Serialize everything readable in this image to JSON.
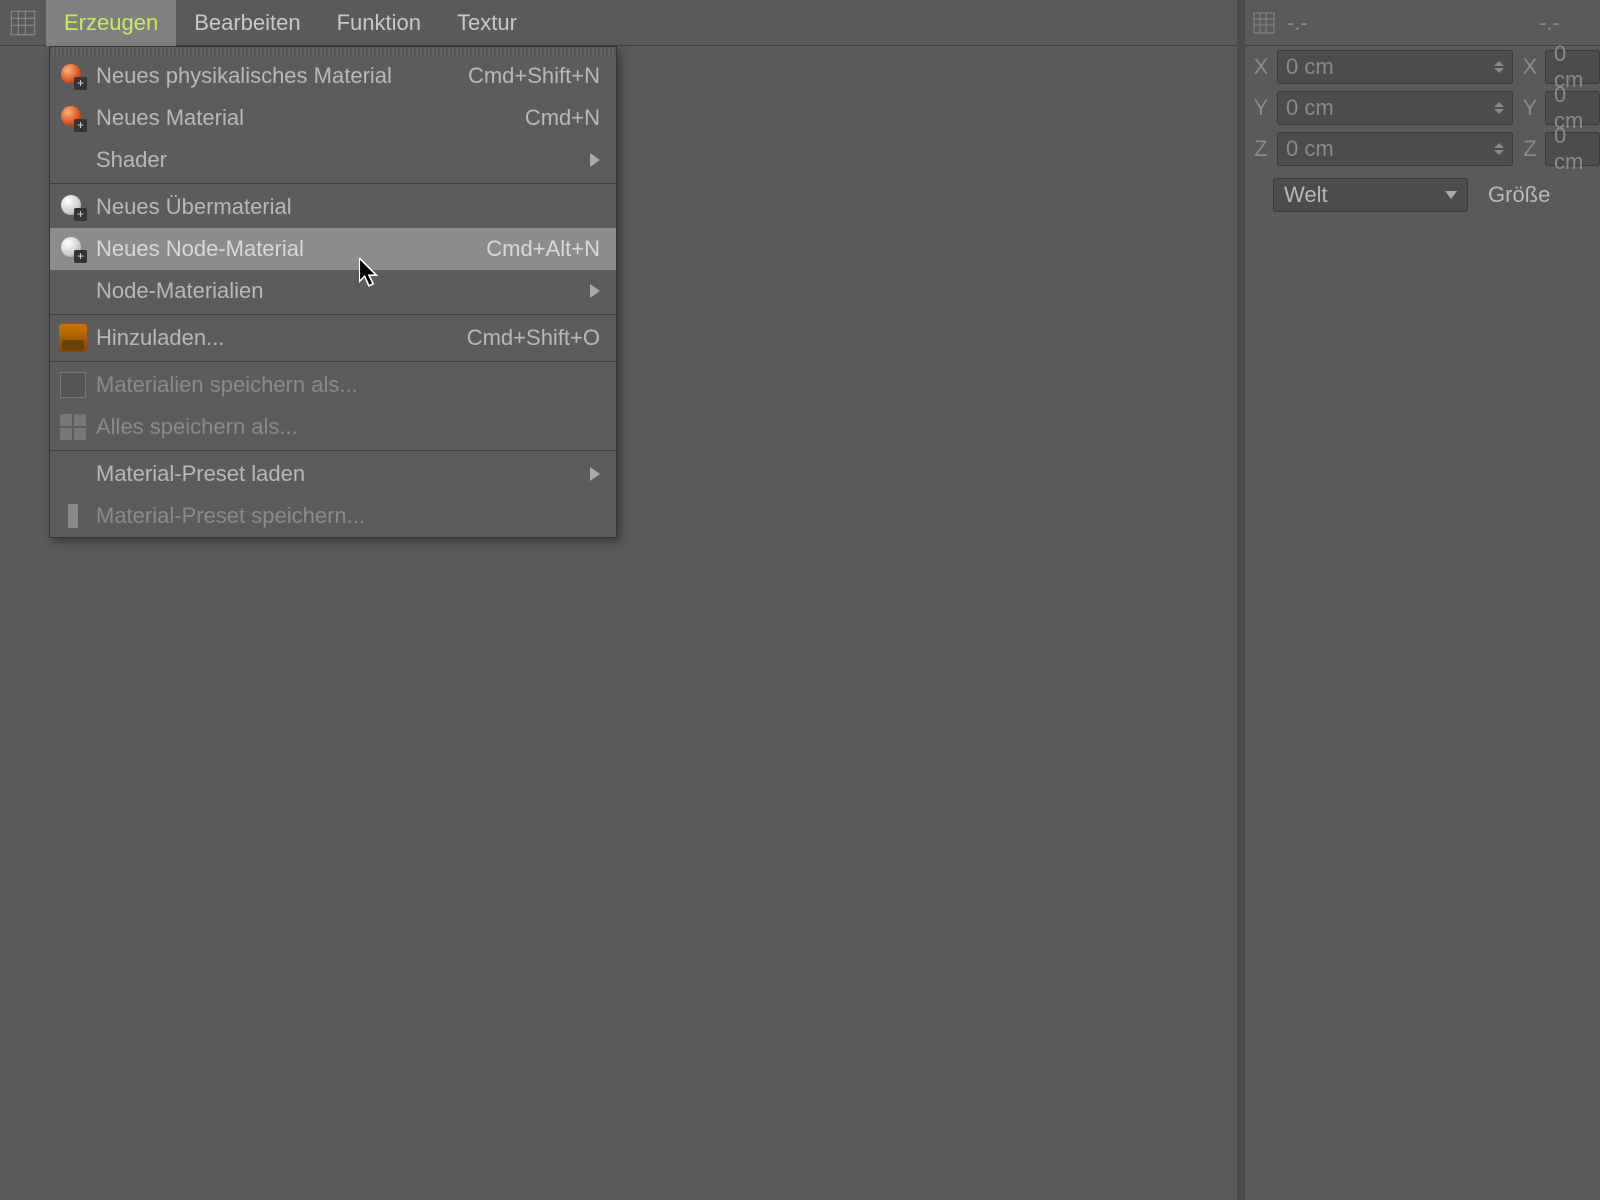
{
  "menubar": {
    "tabs": [
      {
        "label": "Erzeugen",
        "active": true
      },
      {
        "label": "Bearbeiten",
        "active": false
      },
      {
        "label": "Funktion",
        "active": false
      },
      {
        "label": "Textur",
        "active": false
      }
    ]
  },
  "dropdown": {
    "items": [
      {
        "label": "Neues physikalisches Material",
        "shortcut": "Cmd+Shift+N",
        "icon": "sphere"
      },
      {
        "label": "Neues Material",
        "shortcut": "Cmd+N",
        "icon": "sphere"
      },
      {
        "label": "Shader",
        "submenu": true
      },
      {
        "sep": true
      },
      {
        "label": "Neues Übermaterial",
        "icon": "node"
      },
      {
        "label": "Neues Node-Material",
        "shortcut": "Cmd+Alt+N",
        "icon": "node",
        "highlighted": true
      },
      {
        "label": "Node-Materialien",
        "submenu": true
      },
      {
        "sep": true
      },
      {
        "label": "Hinzuladen...",
        "shortcut": "Cmd+Shift+O",
        "icon": "load"
      },
      {
        "sep": true
      },
      {
        "label": "Materialien speichern als...",
        "icon": "save",
        "disabled": true
      },
      {
        "label": "Alles speichern als...",
        "icon": "grid",
        "disabled": true
      },
      {
        "sep": true
      },
      {
        "label": "Material-Preset laden",
        "submenu": true
      },
      {
        "label": "Material-Preset speichern...",
        "icon": "preset",
        "disabled": true
      }
    ]
  },
  "side": {
    "header1": "-.-",
    "header2": "-.-",
    "rows": [
      {
        "l1": "X",
        "v1": "0 cm",
        "l2": "X",
        "v2": "0 cm"
      },
      {
        "l1": "Y",
        "v1": "0 cm",
        "l2": "Y",
        "v2": "0 cm"
      },
      {
        "l1": "Z",
        "v1": "0 cm",
        "l2": "Z",
        "v2": "0 cm"
      }
    ],
    "dropdown": "Welt",
    "button": "Größe"
  }
}
